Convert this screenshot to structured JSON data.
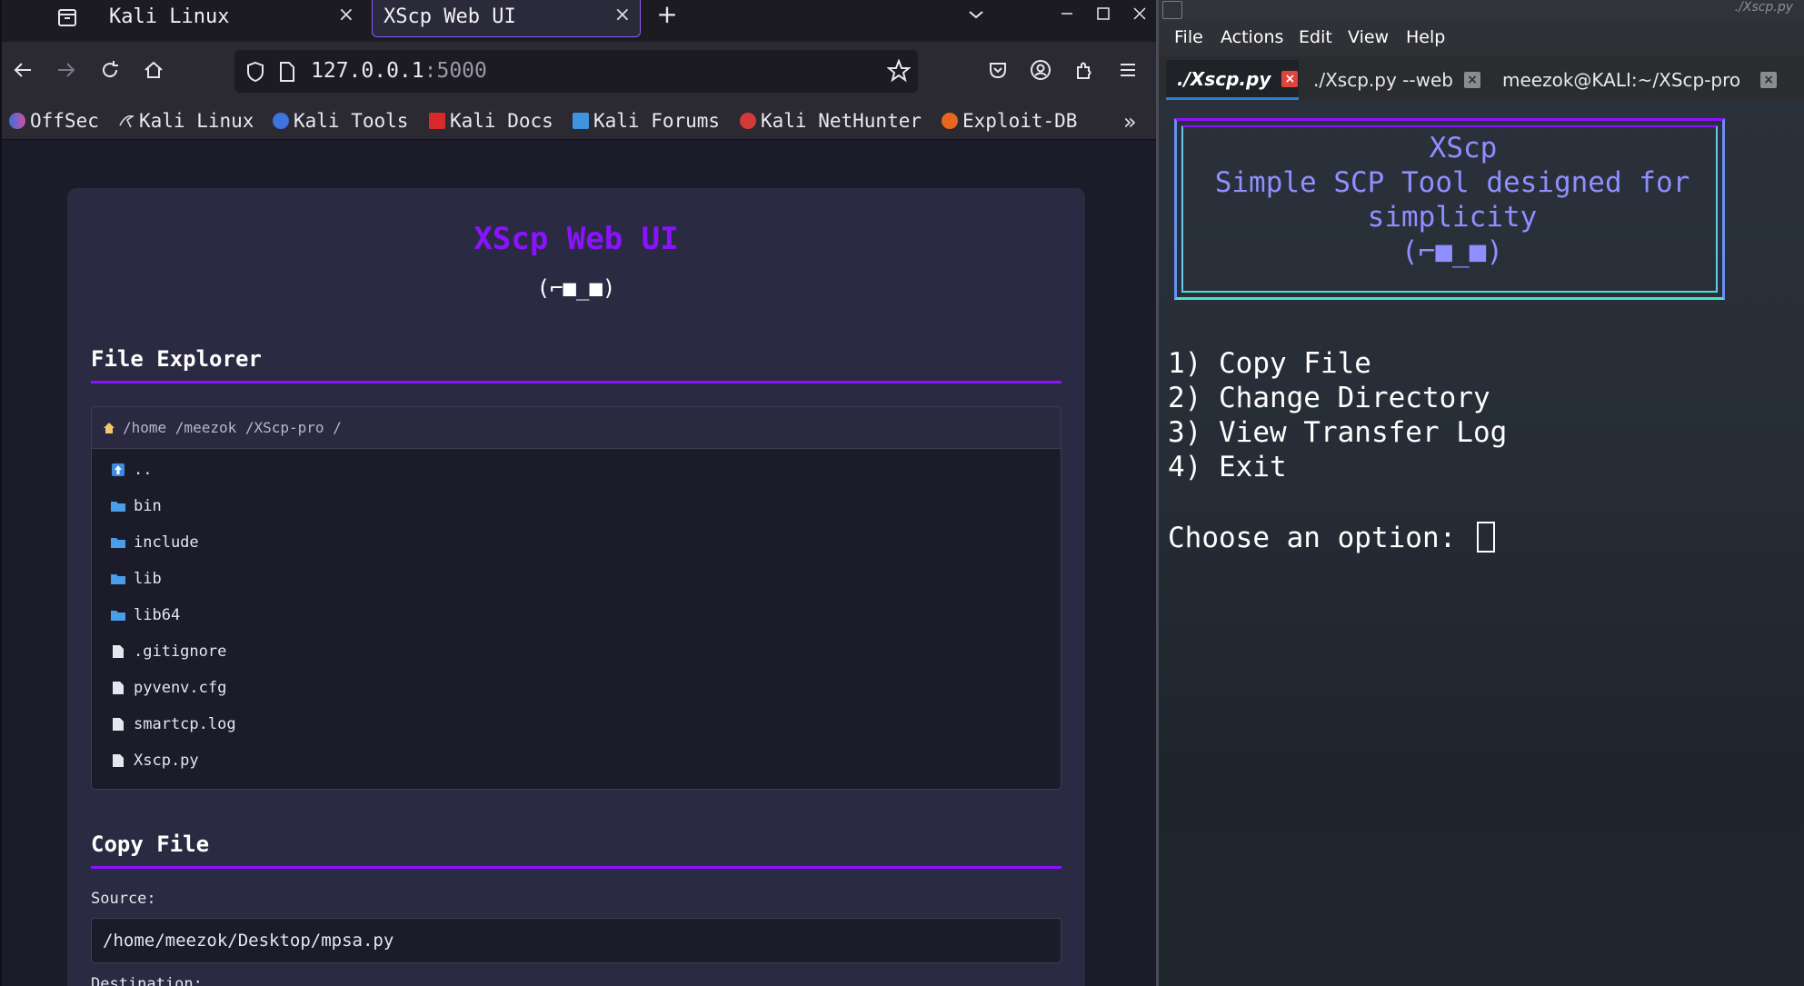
{
  "browser": {
    "tabs": [
      {
        "label": "Kali Linux",
        "active": false
      },
      {
        "label": "XScp Web UI",
        "active": true
      }
    ],
    "url": {
      "host": "127.0.0.1",
      "port": ":5000"
    },
    "bookmarks": [
      "OffSec",
      "Kali Linux",
      "Kali Tools",
      "Kali Docs",
      "Kali Forums",
      "Kali NetHunter",
      "Exploit-DB"
    ]
  },
  "page": {
    "title": "XScp Web UI",
    "face": "(⌐■_■)",
    "file_explorer": {
      "heading": "File Explorer",
      "path": "/home /meezok /XScp-pro /",
      "entries": [
        {
          "name": "..",
          "type": "parent"
        },
        {
          "name": "bin",
          "type": "folder"
        },
        {
          "name": "include",
          "type": "folder"
        },
        {
          "name": "lib",
          "type": "folder"
        },
        {
          "name": "lib64",
          "type": "folder"
        },
        {
          "name": ".gitignore",
          "type": "file"
        },
        {
          "name": "pyvenv.cfg",
          "type": "file"
        },
        {
          "name": "smartcp.log",
          "type": "file"
        },
        {
          "name": "Xscp.py",
          "type": "file"
        }
      ]
    },
    "copy_file": {
      "heading": "Copy File",
      "source_label": "Source:",
      "source_value": "/home/meezok/Desktop/mpsa.py",
      "destination_label": "Destination:"
    }
  },
  "terminal": {
    "window_title": "./Xscp.py",
    "menu": [
      "File",
      "Actions",
      "Edit",
      "View",
      "Help"
    ],
    "tabs": [
      {
        "label": "./Xscp.py",
        "active": true
      },
      {
        "label": "./Xscp.py --web",
        "active": false
      },
      {
        "label": "meezok@KALI:~/XScp-pro",
        "active": false
      }
    ],
    "banner": [
      "XScp",
      "Simple SCP Tool designed for",
      "simplicity",
      "(⌐■_■)"
    ],
    "options": [
      "1) Copy File",
      "2) Change Directory",
      "3) View Transfer Log",
      "4) Exit"
    ],
    "prompt": "Choose an option: "
  },
  "colors": {
    "accent_purple": "#8b12ff",
    "banner_text": "#8f8fff",
    "terminal_tab_active_underline": "#2a7fd6"
  }
}
